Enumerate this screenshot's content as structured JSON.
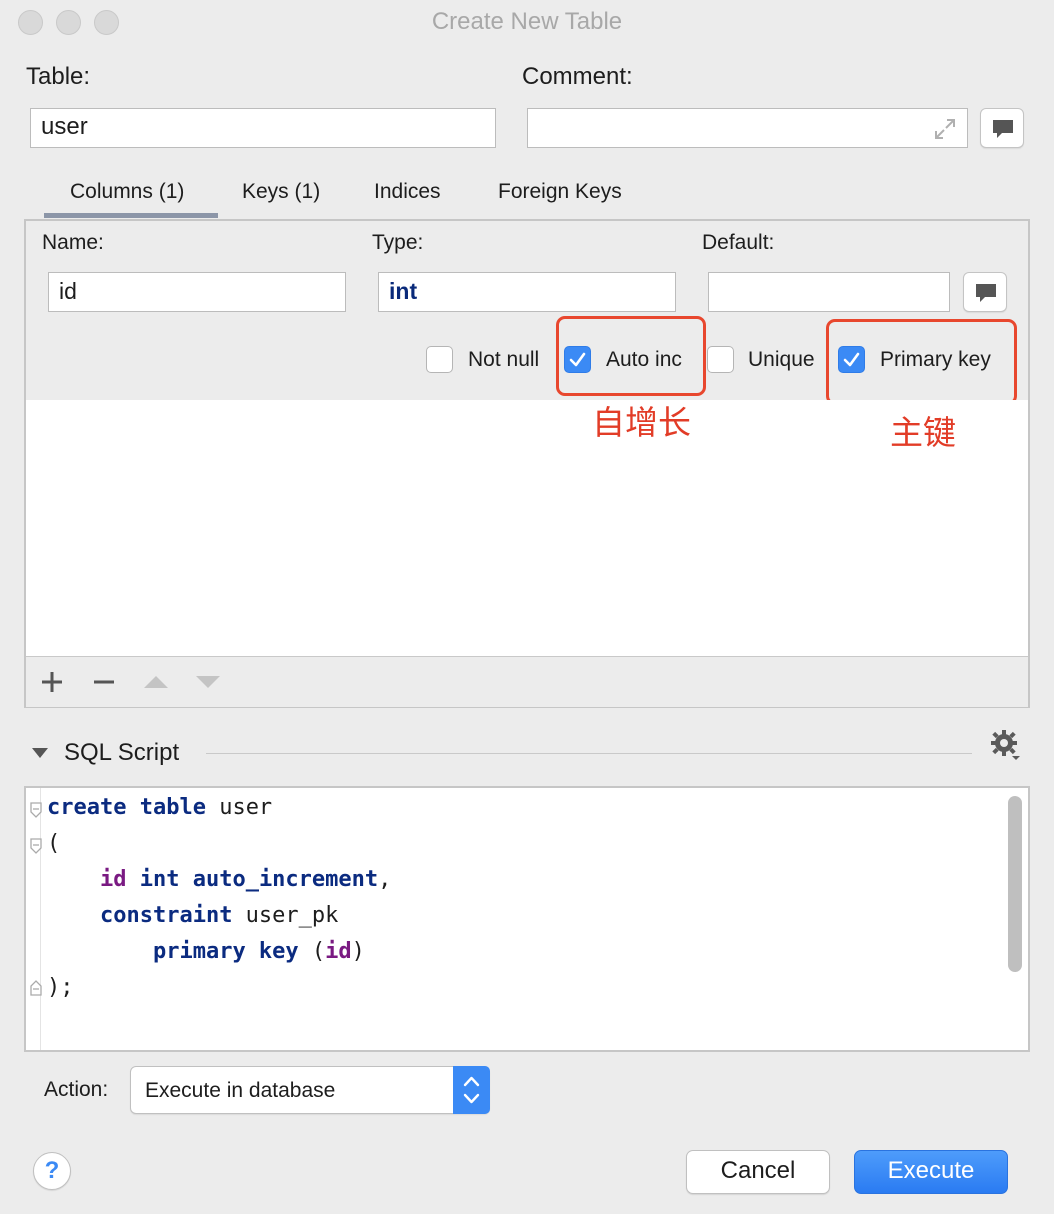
{
  "window": {
    "title": "Create New Table"
  },
  "table_field": {
    "label": "Table:",
    "value": "user"
  },
  "comment_field": {
    "label": "Comment:",
    "value": ""
  },
  "tabs": [
    {
      "label": "Columns (1)",
      "selected": true
    },
    {
      "label": "Keys (1)",
      "selected": false
    },
    {
      "label": "Indices",
      "selected": false
    },
    {
      "label": "Foreign Keys",
      "selected": false
    }
  ],
  "column": {
    "name_label": "Name:",
    "name_value": "id",
    "type_label": "Type:",
    "type_value": "int",
    "default_label": "Default:",
    "default_value": "",
    "options": [
      {
        "label": "Not null",
        "checked": false
      },
      {
        "label": "Auto inc",
        "checked": true
      },
      {
        "label": "Unique",
        "checked": false
      },
      {
        "label": "Primary key",
        "checked": true
      }
    ]
  },
  "annotations": {
    "auto_inc": "自增长",
    "primary_key": "主键",
    "color": "#e23c27"
  },
  "toolbar": {
    "icons": [
      "add-icon",
      "remove-icon",
      "move-up-icon",
      "move-down-icon"
    ]
  },
  "sql_section": {
    "title": "SQL Script",
    "lines": [
      "create table user",
      "(",
      "id int auto_increment,",
      "constraint user_pk",
      "primary key (id)",
      ");"
    ]
  },
  "action": {
    "label": "Action:",
    "selected": "Execute in database"
  },
  "buttons": {
    "help": "?",
    "cancel": "Cancel",
    "execute": "Execute"
  },
  "colors": {
    "accent": "#3b8af5",
    "highlight_box": "#e8472e"
  }
}
